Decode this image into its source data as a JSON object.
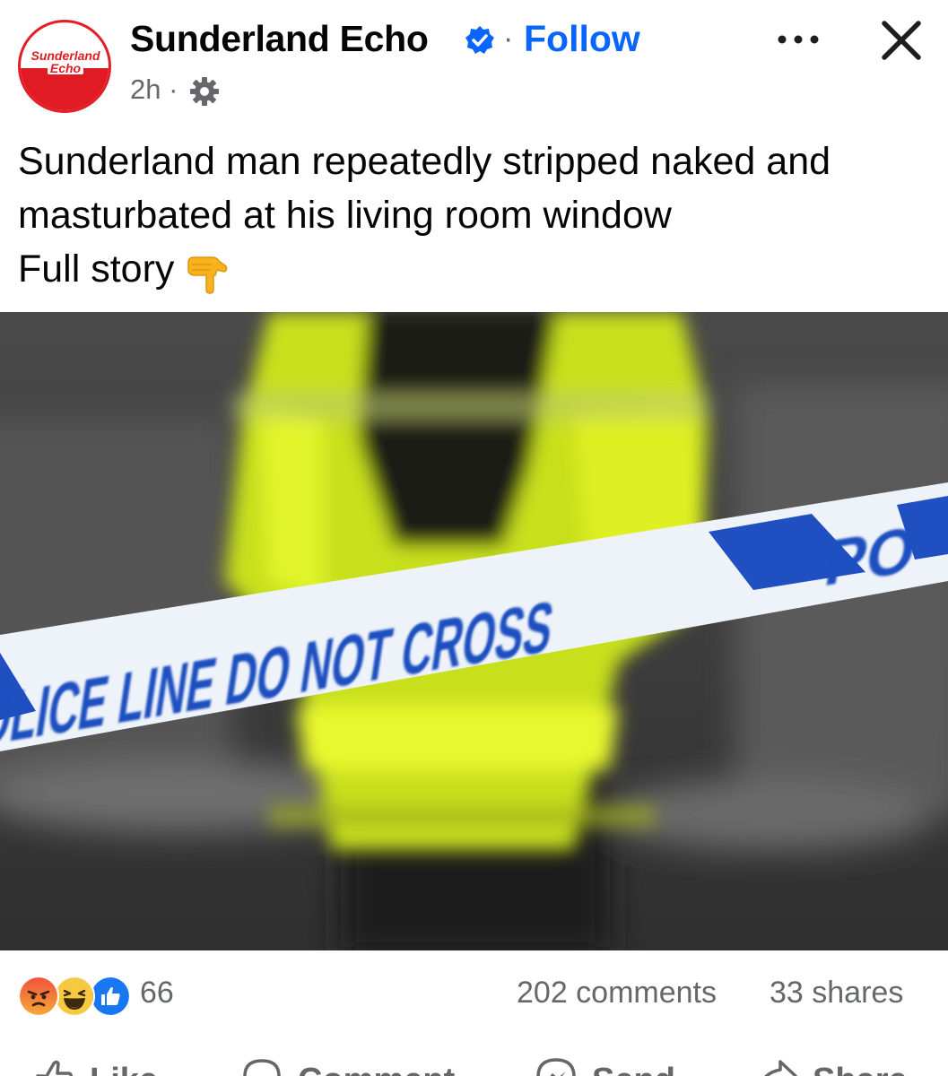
{
  "post": {
    "author": "Sunderland Echo",
    "avatar_logo": [
      "Sunderland",
      "Echo"
    ],
    "follow_label": "Follow",
    "separator": "·",
    "time": "2h ·",
    "text_lines": [
      "Sunderland man repeatedly stripped naked and",
      "masturbated at his living room window",
      "Full story"
    ],
    "emoji": "backhand-index-pointing-down",
    "image": {
      "tape_text": "POLICE LINE DO NOT CROSS",
      "tape_partial": "PO",
      "colors": {
        "hi_vis": "#d8f21c",
        "tape_blue": "#1f4fc0",
        "tape_white": "#f4f6fb"
      }
    }
  },
  "stats": {
    "reactions": [
      "angry",
      "haha",
      "like"
    ],
    "reaction_count": "66",
    "comments": "202 comments",
    "shares": "33 shares"
  },
  "actions": {
    "like": "Like",
    "comment": "Comment",
    "send": "Send",
    "share": "Share"
  },
  "colors": {
    "accent": "#0866ff",
    "muted": "#65676b",
    "brand_red": "#e01b24"
  }
}
